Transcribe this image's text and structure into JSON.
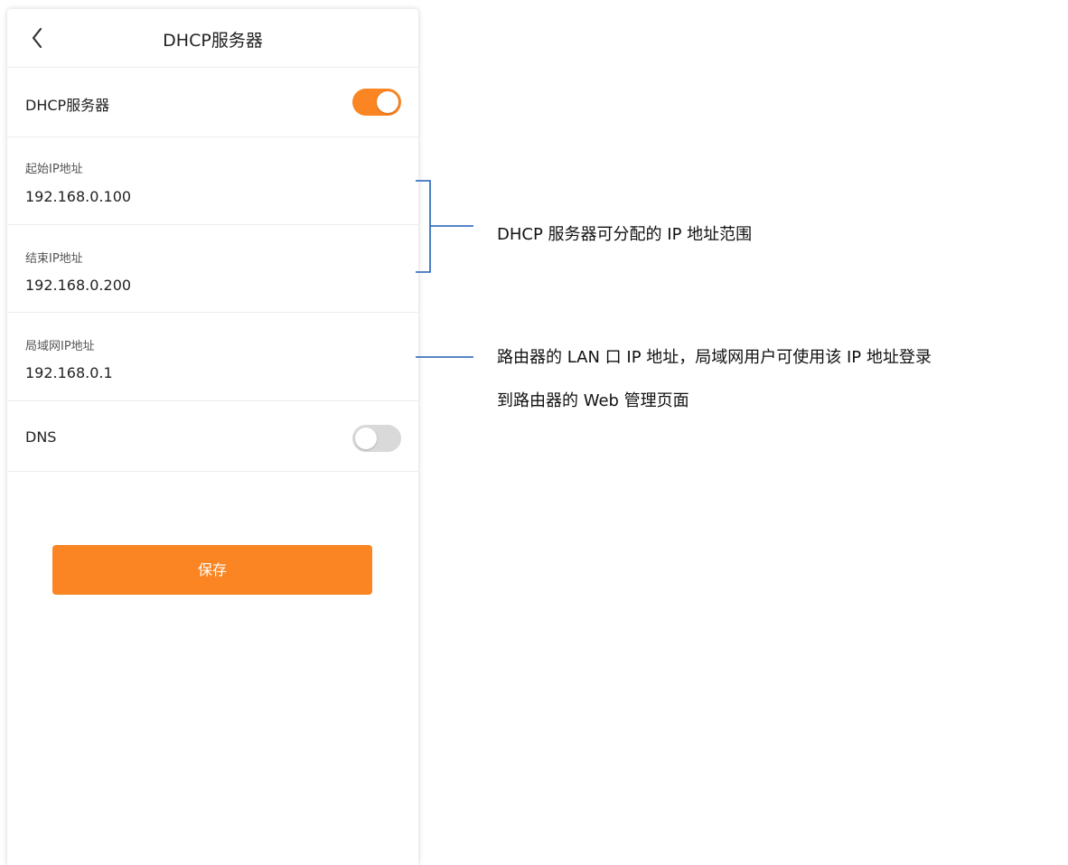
{
  "header": {
    "title": "DHCP服务器",
    "back_icon": "chevron-left-icon"
  },
  "dhcp_server": {
    "label": "DHCP服务器",
    "enabled": true
  },
  "start_ip": {
    "label": "起始IP地址",
    "value": "192.168.0.100"
  },
  "end_ip": {
    "label": "结束IP地址",
    "value": "192.168.0.200"
  },
  "lan_ip": {
    "label": "局域网IP地址",
    "value": "192.168.0.1"
  },
  "dns": {
    "label": "DNS",
    "enabled": false
  },
  "save_button": {
    "label": "保存"
  },
  "annotations": {
    "ip_range": "DHCP 服务器可分配的 IP 地址范围",
    "lan_line1": "路由器的 LAN 口 IP 地址，局域网用户可使用该 IP 地址登录",
    "lan_line2": "到路由器的 Web 管理页面"
  },
  "colors": {
    "accent": "#FA8522",
    "toggle_off": "#D9D9D9",
    "annotation_line": "#1F5FB5"
  }
}
